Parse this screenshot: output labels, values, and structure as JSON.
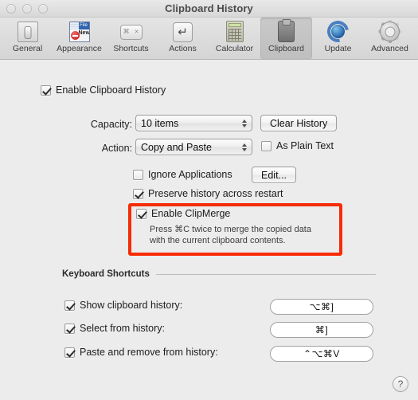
{
  "window": {
    "title": "Clipboard History",
    "traffic_lights": [
      "close-button",
      "minimize-button",
      "zoom-button"
    ]
  },
  "toolbar": {
    "items": [
      {
        "label": "General",
        "icon": "general-icon",
        "selected": false
      },
      {
        "label": "Appearance",
        "icon": "appearance-icon",
        "selected": false
      },
      {
        "label": "Shortcuts",
        "icon": "shortcuts-icon",
        "selected": false
      },
      {
        "label": "Actions",
        "icon": "actions-icon",
        "selected": false
      },
      {
        "label": "Calculator",
        "icon": "calculator-icon",
        "selected": false
      },
      {
        "label": "Clipboard",
        "icon": "clipboard-icon",
        "selected": true
      },
      {
        "label": "Update",
        "icon": "update-icon",
        "selected": false
      },
      {
        "label": "Advanced",
        "icon": "advanced-icon",
        "selected": false
      }
    ]
  },
  "main": {
    "enable_history": {
      "label": "Enable Clipboard History",
      "checked": true
    },
    "capacity": {
      "label": "Capacity:",
      "value": "10 items",
      "options": [
        "10 items"
      ]
    },
    "clear_history_button": "Clear History",
    "action": {
      "label": "Action:",
      "value": "Copy and Paste",
      "options": [
        "Copy and Paste"
      ]
    },
    "as_plain_text": {
      "label": "As Plain Text",
      "checked": false
    },
    "ignore_applications": {
      "label": "Ignore Applications",
      "checked": false
    },
    "edit_button": "Edit...",
    "preserve_history": {
      "label": "Preserve history across restart",
      "checked": true
    },
    "clipmerge": {
      "label": "Enable ClipMerge",
      "checked": true,
      "hint_line1": "Press ⌘C twice to merge the copied data",
      "hint_line2": "with the current clipboard contents."
    },
    "highlight_color": "#f62c06"
  },
  "shortcuts_section": {
    "title": "Keyboard Shortcuts",
    "rows": [
      {
        "label": "Show clipboard history:",
        "checked": true,
        "keys": "⌥⌘]"
      },
      {
        "label": "Select from history:",
        "checked": true,
        "keys": "⌘]"
      },
      {
        "label": "Paste and remove from history:",
        "checked": true,
        "keys": "⌃⌥⌘V"
      }
    ]
  },
  "help_button": "?"
}
